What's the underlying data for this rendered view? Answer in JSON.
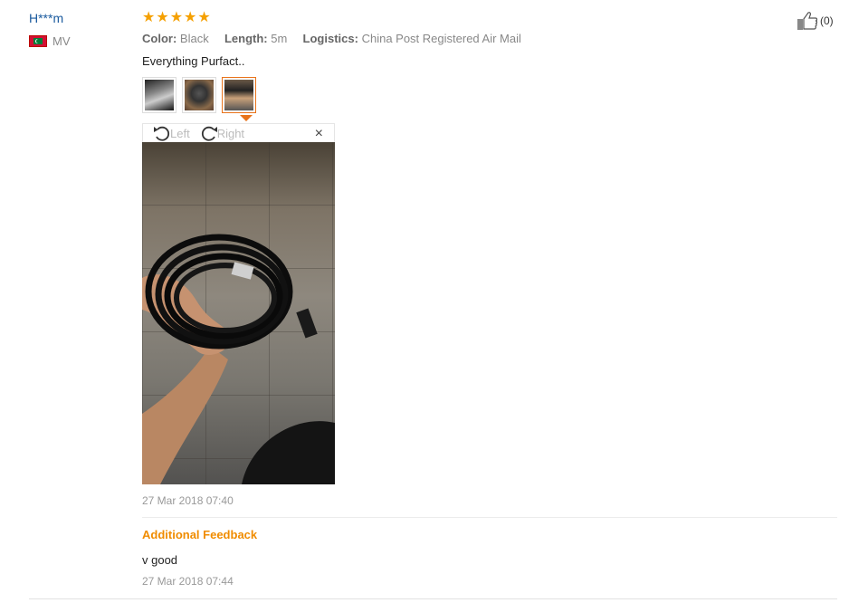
{
  "review": {
    "user": "H***m",
    "country_code": "MV",
    "rating": 5,
    "attributes": [
      {
        "key": "Color:",
        "value": "Black"
      },
      {
        "key": "Length:",
        "value": "5m"
      },
      {
        "key": "Logistics:",
        "value": "China Post Registered Air Mail"
      }
    ],
    "text": "Everything Purfact..",
    "viewer": {
      "rotate_left": "Left",
      "rotate_right": "Right",
      "close": "×"
    },
    "date": "27 Mar 2018 07:40",
    "helpful_count": "(0)"
  },
  "additional": {
    "title": "Additional Feedback",
    "text": "v good",
    "date": "27 Mar 2018 07:44"
  }
}
